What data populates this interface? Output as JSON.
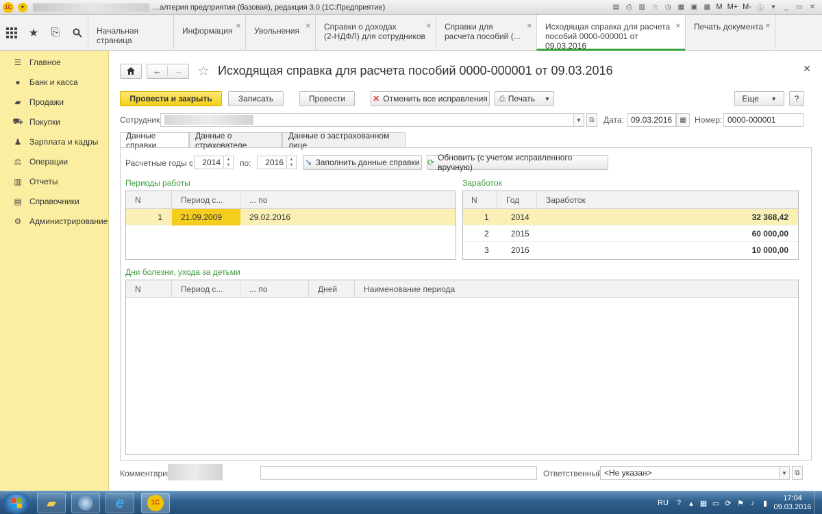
{
  "window": {
    "title": "…алтерия предприятия (базовая), редакция 3.0  (1С:Предприятие)",
    "tools": [
      "M",
      "M+",
      "M-"
    ]
  },
  "tabs": [
    {
      "label": "Начальная страница",
      "closable": false
    },
    {
      "label": "Информация",
      "closable": true
    },
    {
      "label": "Увольнения",
      "closable": true
    },
    {
      "label": "Справки о доходах\n(2-НДФЛ) для сотрудников",
      "closable": true
    },
    {
      "label": "Справки для\nрасчета пособий (...",
      "closable": true
    },
    {
      "label": "Исходящая справка для расчета\nпособий 0000-000001 от 09.03.2016",
      "closable": true,
      "active": true
    },
    {
      "label": "Печать документа",
      "closable": true
    }
  ],
  "sidebar": {
    "items": [
      {
        "label": "Главное",
        "icon": "menu-icon"
      },
      {
        "label": "Банк и касса",
        "icon": "ruble-icon"
      },
      {
        "label": "Продажи",
        "icon": "bag-icon"
      },
      {
        "label": "Покупки",
        "icon": "cart-icon"
      },
      {
        "label": "Зарплата и кадры",
        "icon": "people-icon"
      },
      {
        "label": "Операции",
        "icon": "operations-icon"
      },
      {
        "label": "Отчеты",
        "icon": "chart-icon"
      },
      {
        "label": "Справочники",
        "icon": "book-icon"
      },
      {
        "label": "Администрирование",
        "icon": "gear-icon"
      }
    ]
  },
  "form": {
    "title": "Исходящая справка для расчета пособий 0000-000001 от 09.03.2016",
    "buttons": {
      "post_close": "Провести и закрыть",
      "save": "Записать",
      "post": "Провести",
      "cancel_fixes": "Отменить все исправления",
      "print": "Печать",
      "more": "Еще",
      "help": "?"
    },
    "employee_label": "Сотрудник:",
    "date_label": "Дата:",
    "date_value": "09.03.2016",
    "number_label": "Номер:",
    "number_value": "0000-000001",
    "tabs": [
      "Данные справки",
      "Данные о страхователе",
      "Данные о застрахованном лице"
    ],
    "years_label": "Расчетные годы с:",
    "year_from": "2014",
    "to_label": "по:",
    "year_to": "2016",
    "fill_button": "Заполнить данные справки",
    "refresh_button": "Обновить (с учетом исправленного вручную)",
    "work_periods": {
      "title": "Периоды работы",
      "columns": [
        "N",
        "Период с...",
        "... по"
      ],
      "rows": [
        [
          "1",
          "21.09.2009",
          "29.02.2016"
        ]
      ]
    },
    "earnings": {
      "title": "Заработок",
      "columns": [
        "N",
        "Год",
        "Заработок"
      ],
      "rows": [
        [
          "1",
          "2014",
          "32 368,42"
        ],
        [
          "2",
          "2015",
          "60 000,00"
        ],
        [
          "3",
          "2016",
          "10 000,00"
        ]
      ]
    },
    "sick_days": {
      "title": "Дни болезни, ухода за детьми",
      "columns": [
        "N",
        "Период с...",
        "... по",
        "Дней",
        "Наименование периода"
      ]
    },
    "comment_label": "Комментарий:",
    "responsible_label": "Ответственный:",
    "responsible_value": "<Не указан>"
  },
  "taskbar": {
    "lang": "RU",
    "time": "17:04",
    "date": "09.03.2016"
  }
}
